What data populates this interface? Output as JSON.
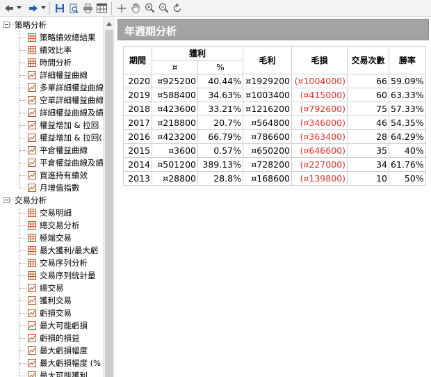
{
  "tree": {
    "groups": [
      {
        "label": "策略分析",
        "items": [
          {
            "label": "策略績效總結果",
            "icon": "table-icon"
          },
          {
            "label": "績效比率",
            "icon": "table-icon"
          },
          {
            "label": "時間分析",
            "icon": "table-icon"
          },
          {
            "label": "詳細權益曲線",
            "icon": "chart-icon"
          },
          {
            "label": "多單詳細權益曲線",
            "icon": "chart-icon"
          },
          {
            "label": "空單詳細權益曲線",
            "icon": "chart-icon"
          },
          {
            "label": "詳細權益曲線及績",
            "icon": "chart-icon"
          },
          {
            "label": "權益增加 & 拉回",
            "icon": "chart-icon"
          },
          {
            "label": "權益增加 & 拉回(",
            "icon": "chart-icon"
          },
          {
            "label": "平倉權益曲線",
            "icon": "chart-icon"
          },
          {
            "label": "平倉權益曲線及績",
            "icon": "chart-icon"
          },
          {
            "label": "買進持有績效",
            "icon": "chart-icon"
          },
          {
            "label": "月增值指數",
            "icon": "chart-icon"
          }
        ]
      },
      {
        "label": "交易分析",
        "items": [
          {
            "label": "交易明細",
            "icon": "table-icon"
          },
          {
            "label": "總交易分析",
            "icon": "table-icon"
          },
          {
            "label": "極端交易",
            "icon": "table-icon"
          },
          {
            "label": "最大獲利/最大虧",
            "icon": "table-icon"
          },
          {
            "label": "交易序列分析",
            "icon": "table-icon"
          },
          {
            "label": "交易序列統計量",
            "icon": "table-icon"
          },
          {
            "label": "總交易",
            "icon": "chart-icon"
          },
          {
            "label": "獲利交易",
            "icon": "chart-icon"
          },
          {
            "label": "虧損交易",
            "icon": "chart-icon"
          },
          {
            "label": "最大可能虧損",
            "icon": "chart-icon"
          },
          {
            "label": "虧損的損益",
            "icon": "chart-icon"
          },
          {
            "label": "最大虧損幅度",
            "icon": "chart-icon"
          },
          {
            "label": "最大虧損幅度 (%",
            "icon": "chart-icon"
          },
          {
            "label": "最大可能獲利",
            "icon": "chart-icon"
          }
        ]
      }
    ]
  },
  "content": {
    "title": "年週期分析",
    "table": {
      "headers": {
        "period": "期間",
        "profit_group": "獲利",
        "profit_currency": "¤",
        "profit_percent": "%",
        "gross_profit": "毛利",
        "gross_loss": "毛損",
        "trade_count": "交易次數",
        "win_rate": "勝率"
      },
      "rows": [
        {
          "year": "2020",
          "profit": "¤925200",
          "pct": "40.44%",
          "gross_profit": "¤1929200",
          "gross_loss": "(¤1004000)",
          "count": "66",
          "win_rate": "59.09%"
        },
        {
          "year": "2019",
          "profit": "¤588400",
          "pct": "34.63%",
          "gross_profit": "¤1003400",
          "gross_loss": "(¤415000)",
          "count": "60",
          "win_rate": "63.33%"
        },
        {
          "year": "2018",
          "profit": "¤423600",
          "pct": "33.21%",
          "gross_profit": "¤1216200",
          "gross_loss": "(¤792600)",
          "count": "75",
          "win_rate": "57.33%"
        },
        {
          "year": "2017",
          "profit": "¤218800",
          "pct": "20.7%",
          "gross_profit": "¤564800",
          "gross_loss": "(¤346000)",
          "count": "46",
          "win_rate": "54.35%"
        },
        {
          "year": "2016",
          "profit": "¤423200",
          "pct": "66.79%",
          "gross_profit": "¤786600",
          "gross_loss": "(¤363400)",
          "count": "28",
          "win_rate": "64.29%"
        },
        {
          "year": "2015",
          "profit": "¤3600",
          "pct": "0.57%",
          "gross_profit": "¤650200",
          "gross_loss": "(¤646600)",
          "count": "35",
          "win_rate": "40%"
        },
        {
          "year": "2014",
          "profit": "¤501200",
          "pct": "389.13%",
          "gross_profit": "¤728200",
          "gross_loss": "(¤227000)",
          "count": "34",
          "win_rate": "61.76%"
        },
        {
          "year": "2013",
          "profit": "¤28800",
          "pct": "28.8%",
          "gross_profit": "¤168600",
          "gross_loss": "(¤139800)",
          "count": "10",
          "win_rate": "50%"
        }
      ]
    }
  },
  "colors": {
    "negative": "#e8322c",
    "header_bar": "#a3a3a3",
    "toolbar_icon": "#1f5fa8"
  }
}
